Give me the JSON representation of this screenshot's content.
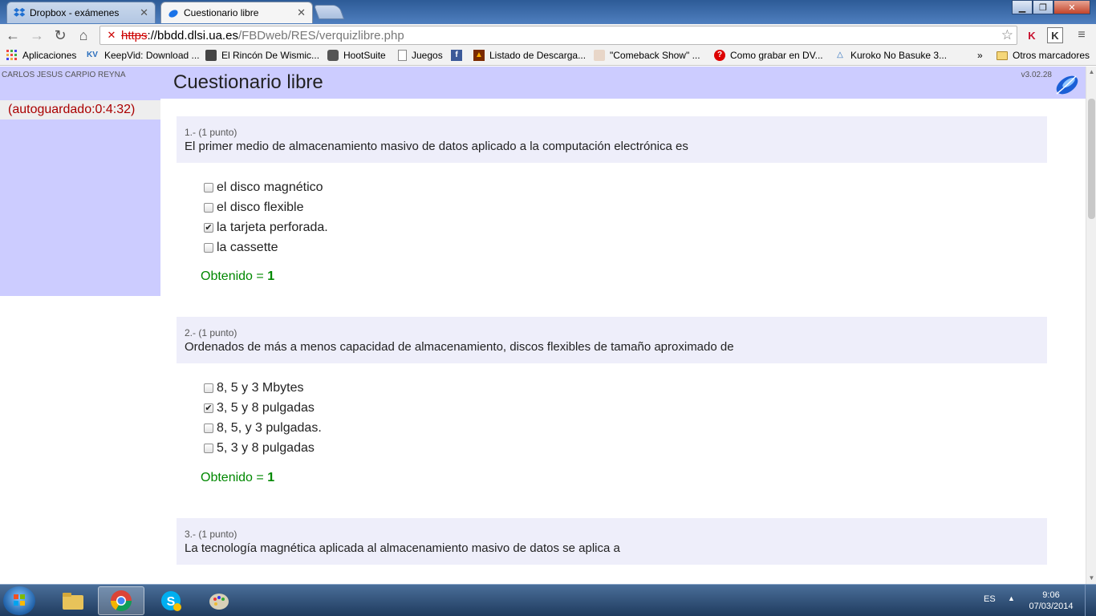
{
  "tabs": [
    {
      "title": "Dropbox - exámenes"
    },
    {
      "title": "Cuestionario libre"
    }
  ],
  "omnibox": {
    "url_scheme": "https",
    "url_host": "://bbdd.dlsi.ua.es",
    "url_path": "/FBDweb/RES/verquizlibre.php"
  },
  "bookmarks": {
    "items": [
      {
        "label": "Aplicaciones",
        "icon": "apps-grid-icon"
      },
      {
        "label": "KeepVid: Download ...",
        "icon": "keepvid-icon"
      },
      {
        "label": "El Rincón De Wismic...",
        "icon": "avatar-icon"
      },
      {
        "label": "HootSuite",
        "icon": "owl-icon"
      },
      {
        "label": "Juegos",
        "icon": "page-icon"
      },
      {
        "label": "",
        "icon": "facebook-icon"
      },
      {
        "label": "Listado de Descarga...",
        "icon": "flame-icon"
      },
      {
        "label": "\"Comeback Show\" ...",
        "icon": "avatar-icon"
      },
      {
        "label": "Como grabar en DV...",
        "icon": "question-icon"
      },
      {
        "label": "Kuroko No Basuke 3...",
        "icon": "triangle-icon"
      }
    ],
    "overflow_label": "»",
    "other_label": "Otros marcadores"
  },
  "page": {
    "user_name": "CARLOS JESUS CARPIO REYNA",
    "title": "Cuestionario libre",
    "version": "v3.02.28",
    "autosave": "(autoguardado:0:4:32)"
  },
  "questions": [
    {
      "meta": "1.- (1 punto)",
      "text": "El primer medio de almacenamiento masivo de datos aplicado a la computación electrónica es",
      "options": [
        "el disco magnético",
        "el disco flexible",
        "la tarjeta perforada.",
        "la cassette"
      ],
      "checked": [
        false,
        false,
        true,
        false
      ],
      "score_label": "Obtenido =",
      "score_value": "1"
    },
    {
      "meta": "2.- (1 punto)",
      "text": "Ordenados de más a menos capacidad de almacenamiento, discos flexibles de tamaño aproximado de",
      "options": [
        "8, 5 y 3 Mbytes",
        "3, 5 y 8 pulgadas",
        "8, 5, y 3 pulgadas.",
        "5, 3 y 8 pulgadas"
      ],
      "checked": [
        false,
        true,
        false,
        false
      ],
      "score_label": "Obtenido =",
      "score_value": "1"
    },
    {
      "meta": "3.- (1 punto)",
      "text": "La tecnología magnética aplicada al almacenamiento masivo de datos se aplica a"
    }
  ],
  "taskbar": {
    "language": "ES",
    "time": "9:06",
    "date": "07/03/2014"
  },
  "colors": {
    "header_bg": "#ccccff",
    "question_bg": "#eeeefa",
    "score": "#008800",
    "autosave": "#aa0000"
  }
}
